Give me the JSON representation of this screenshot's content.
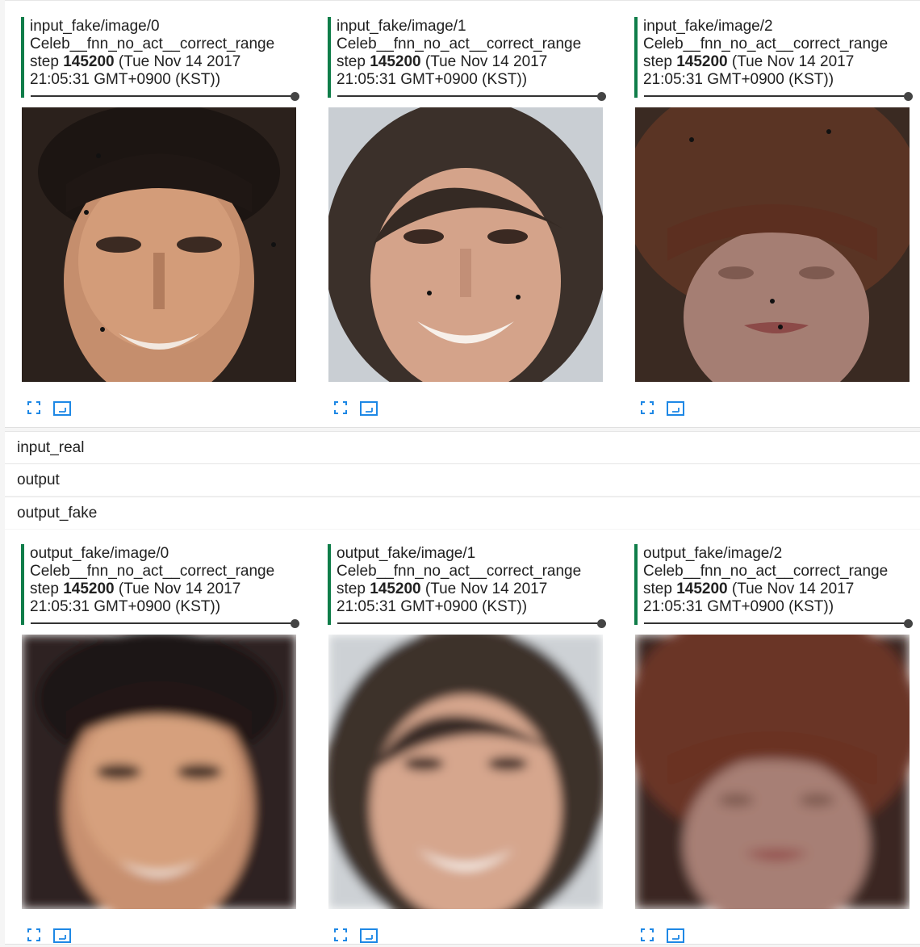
{
  "sections": {
    "input_fake": {
      "panes": [
        {
          "tag": "input_fake/image/0",
          "run": "Celeb__fnn_no_act__correct_range",
          "step_prefix": "step ",
          "step": "145200",
          "time_prefix": " (Tue Nov 14 2017",
          "time_line2": "21:05:31 GMT+0900 (KST))"
        },
        {
          "tag": "input_fake/image/1",
          "run": "Celeb__fnn_no_act__correct_range",
          "step_prefix": "step ",
          "step": "145200",
          "time_prefix": " (Tue Nov 14 2017",
          "time_line2": "21:05:31 GMT+0900 (KST))"
        },
        {
          "tag": "input_fake/image/2",
          "run": "Celeb__fnn_no_act__correct_range",
          "step_prefix": "step ",
          "step": "145200",
          "time_prefix": " (Tue Nov 14 2017",
          "time_line2": "21:05:31 GMT+0900 (KST))"
        }
      ]
    },
    "categories": [
      "input_real",
      "output",
      "output_fake"
    ],
    "output_fake": {
      "panes": [
        {
          "tag": "output_fake/image/0",
          "run": "Celeb__fnn_no_act__correct_range",
          "step_prefix": "step ",
          "step": "145200",
          "time_prefix": " (Tue Nov 14 2017",
          "time_line2": "21:05:31 GMT+0900 (KST))"
        },
        {
          "tag": "output_fake/image/1",
          "run": "Celeb__fnn_no_act__correct_range",
          "step_prefix": "step ",
          "step": "145200",
          "time_prefix": " (Tue Nov 14 2017",
          "time_line2": "21:05:31 GMT+0900 (KST))"
        },
        {
          "tag": "output_fake/image/2",
          "run": "Celeb__fnn_no_act__correct_range",
          "step_prefix": "step ",
          "step": "145200",
          "time_prefix": " (Tue Nov 14 2017",
          "time_line2": "21:05:31 GMT+0900 (KST))"
        }
      ]
    }
  },
  "icons": {
    "fullscreen": "fullscreen-icon",
    "actual_size": "actual-size-icon"
  },
  "colors": {
    "accent": "#0f7d49",
    "icon": "#1e88e5"
  }
}
